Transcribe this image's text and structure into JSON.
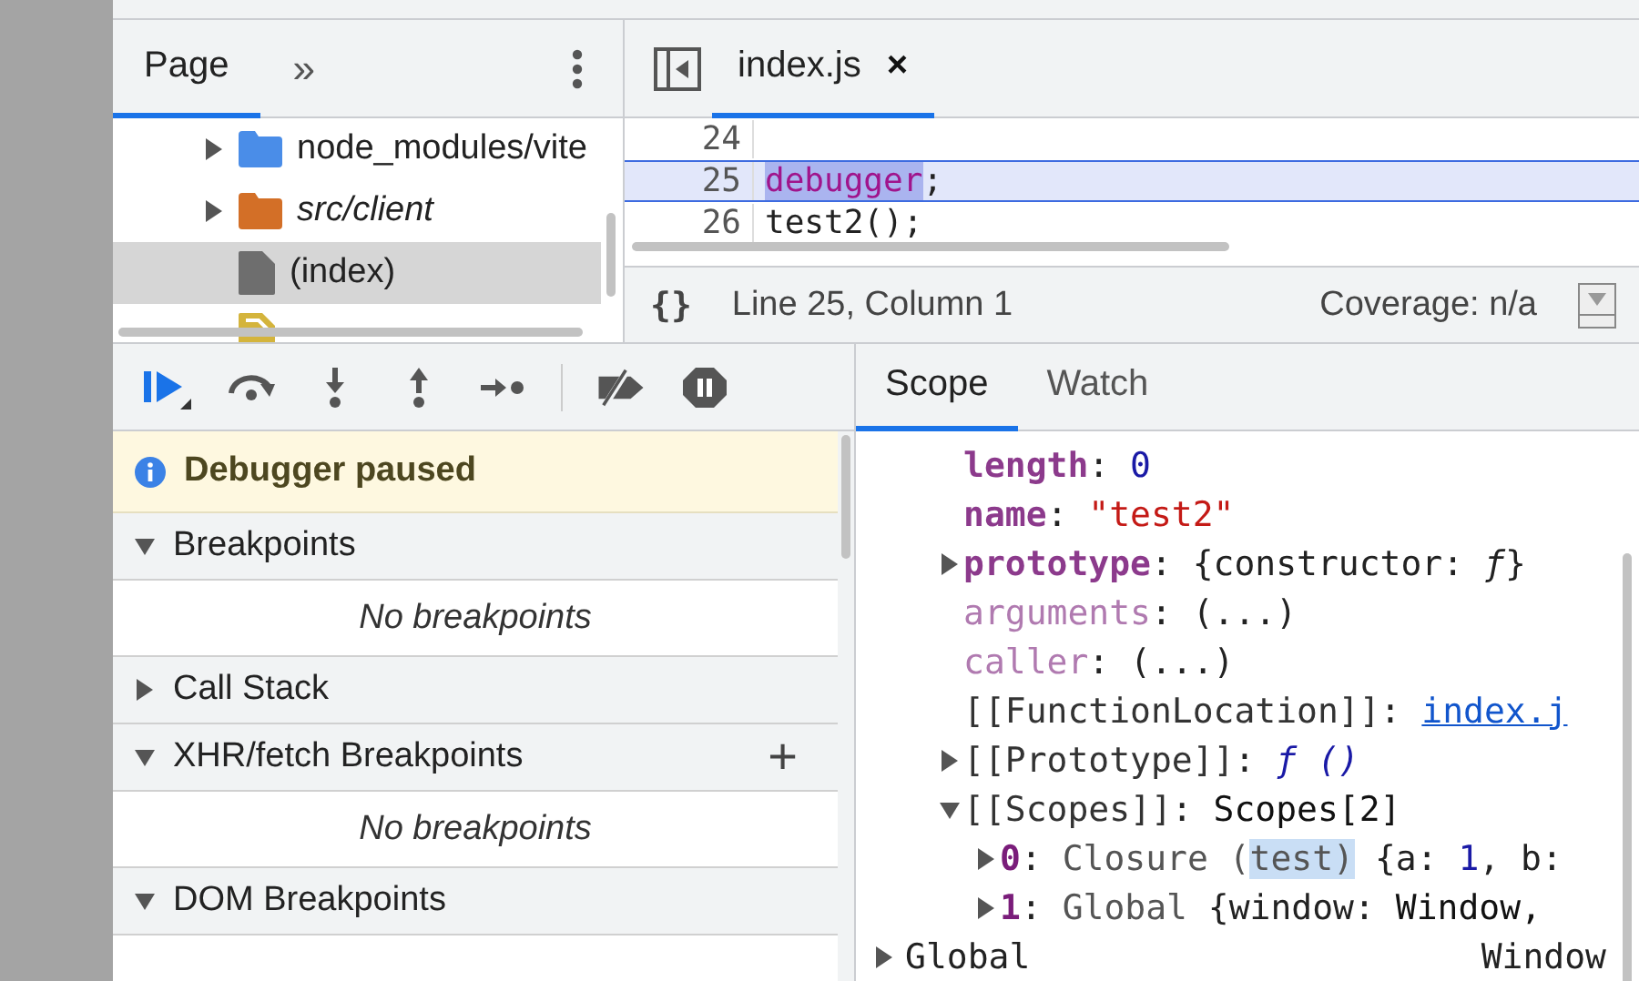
{
  "navigator": {
    "tabs": [
      {
        "label": "Page",
        "selected": true
      }
    ],
    "more": "»",
    "tree": [
      {
        "kind": "folder",
        "label": "node_modules/vite",
        "color": "#4a8de8",
        "italic": false,
        "expanded": false,
        "selected": false
      },
      {
        "kind": "folder",
        "label": "src/client",
        "color": "#d36f27",
        "italic": true,
        "expanded": false,
        "selected": false
      },
      {
        "kind": "file",
        "label": "(index)",
        "color": "#6e6e6e",
        "italic": false,
        "selected": true
      },
      {
        "kind": "script",
        "color": "#d4b43c",
        "selected": false
      }
    ]
  },
  "editor": {
    "tabs": [
      {
        "label": "index.js",
        "close": "×",
        "selected": true
      }
    ],
    "lines": [
      {
        "number": "24",
        "paused": false
      },
      {
        "number": "25",
        "paused": true,
        "tokens": [
          {
            "text": "debugger",
            "kind": "keyword",
            "selected": true
          },
          {
            "text": ";",
            "kind": "plain",
            "selected": false
          }
        ]
      },
      {
        "number": "26",
        "paused": false,
        "tokens": [
          {
            "text": "test2();",
            "kind": "plain",
            "selected": false
          }
        ]
      }
    ],
    "status": {
      "format": "{}",
      "position": "Line 25, Column 1",
      "coverage": "Coverage: n/a"
    }
  },
  "debugger": {
    "paused_message": "Debugger paused",
    "sections": [
      {
        "title": "Breakpoints",
        "expanded": true,
        "empty_text": "No breakpoints"
      },
      {
        "title": "Call Stack",
        "expanded": false
      },
      {
        "title": "XHR/fetch Breakpoints",
        "expanded": true,
        "action": "+",
        "empty_text": "No breakpoints"
      },
      {
        "title": "DOM Breakpoints",
        "expanded": true
      }
    ]
  },
  "sidebar_tabs": [
    {
      "label": "Scope",
      "selected": true
    },
    {
      "label": "Watch",
      "selected": false
    }
  ],
  "scope": {
    "properties": [
      {
        "key": "length",
        "kind": "own",
        "value": [
          {
            "text": ": ",
            "kind": "plain"
          },
          {
            "text": "0",
            "kind": "number"
          }
        ]
      },
      {
        "key": "name",
        "kind": "own",
        "value": [
          {
            "text": ": ",
            "kind": "plain"
          },
          {
            "text": "\"test2\"",
            "kind": "string"
          }
        ]
      },
      {
        "key": "prototype",
        "kind": "own",
        "expanded": false,
        "value": [
          {
            "text": ": {constructor: ",
            "kind": "plain"
          },
          {
            "text": "ƒ",
            "kind": "italic"
          },
          {
            "text": "}",
            "kind": "plain"
          }
        ]
      },
      {
        "key": "arguments",
        "kind": "accessor",
        "value": [
          {
            "text": ": (...)",
            "kind": "plain"
          }
        ]
      },
      {
        "key": "caller",
        "kind": "accessor",
        "value": [
          {
            "text": ": (...)",
            "kind": "plain"
          }
        ]
      },
      {
        "key": "[[FunctionLocation]]",
        "kind": "internal",
        "value": [
          {
            "text": ": ",
            "kind": "plain"
          },
          {
            "text": "index.j",
            "kind": "link"
          }
        ]
      },
      {
        "key": "[[Prototype]]",
        "kind": "internal",
        "expanded": false,
        "value": [
          {
            "text": ": ",
            "kind": "plain"
          },
          {
            "text": "ƒ ()",
            "kind": "function"
          }
        ]
      },
      {
        "key": "[[Scopes]]",
        "kind": "internal",
        "expanded": true,
        "value": [
          {
            "text": ": ",
            "kind": "plain"
          },
          {
            "text": "Scopes[2]",
            "kind": "object"
          }
        ],
        "children": [
          {
            "key": "0",
            "kind": "index",
            "expanded": false,
            "value": [
              {
                "text": ": ",
                "kind": "plain"
              },
              {
                "text": "Closure (",
                "kind": "muted"
              },
              {
                "text": "test)",
                "kind": "selected"
              },
              {
                "text": " {a: ",
                "kind": "plain"
              },
              {
                "text": "1",
                "kind": "number"
              },
              {
                "text": ", b:",
                "kind": "plain"
              }
            ]
          },
          {
            "key": "1",
            "kind": "index",
            "expanded": false,
            "value": [
              {
                "text": ": ",
                "kind": "plain"
              },
              {
                "text": "Global ",
                "kind": "muted"
              },
              {
                "text": "{window: ",
                "kind": "plain"
              },
              {
                "text": "Window,",
                "kind": "object"
              }
            ]
          }
        ]
      }
    ],
    "sections": [
      {
        "name": "Global",
        "value": "Window",
        "expanded": false
      }
    ]
  }
}
